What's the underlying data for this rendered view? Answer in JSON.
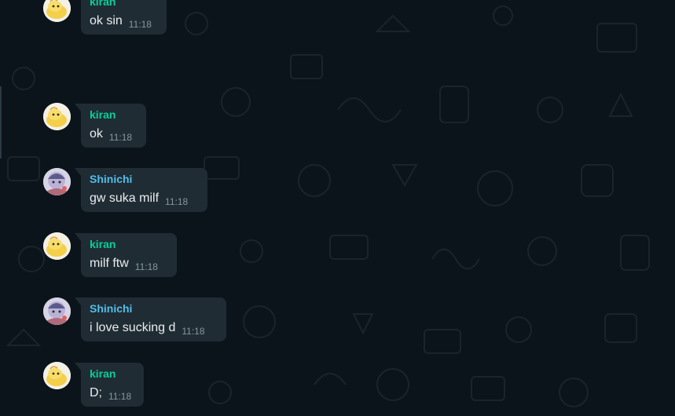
{
  "colors": {
    "chat_background": "#0b141a",
    "bubble_incoming": "#202c33",
    "sender_kiran": "#06cf9c",
    "sender_shinichi": "#53bdeb",
    "message_text": "#e9edef",
    "timestamp": "#8696a0"
  },
  "messages": [
    {
      "sender": "kiran",
      "text": "ok sin",
      "time": "11:18"
    },
    {
      "sender": "kiran",
      "text": "ok",
      "time": "11:18"
    },
    {
      "sender": "Shinichi",
      "text": "gw suka milf",
      "time": "11:18"
    },
    {
      "sender": "kiran",
      "text": "milf ftw",
      "time": "11:18"
    },
    {
      "sender": "Shinichi",
      "text": "i love sucking d",
      "time": "11:18"
    },
    {
      "sender": "kiran",
      "text": "D;",
      "time": "11:18"
    }
  ]
}
